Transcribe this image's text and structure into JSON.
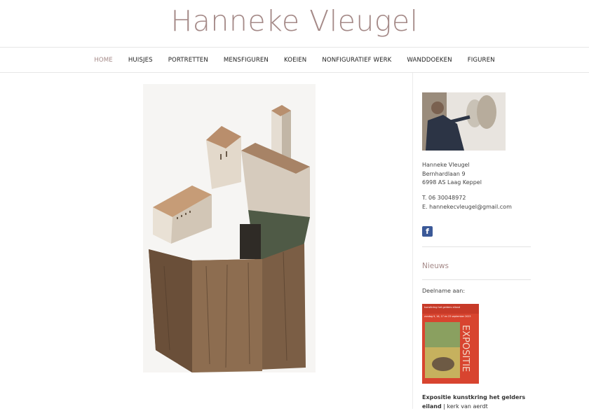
{
  "site": {
    "title": "Hanneke Vleugel"
  },
  "nav": {
    "items": [
      {
        "label": "HOME",
        "active": true
      },
      {
        "label": "HUISJES"
      },
      {
        "label": "PORTRETTEN"
      },
      {
        "label": "MENSFIGUREN"
      },
      {
        "label": "KOEIEN"
      },
      {
        "label": "NONFIGURATIEF WERK"
      },
      {
        "label": "WANDDOEKEN"
      },
      {
        "label": "FIGUREN"
      }
    ]
  },
  "sidebar": {
    "address": {
      "name": "Hanneke Vleugel",
      "street": "Bernhardlaan 9",
      "city": "6998 AS Laag Keppel"
    },
    "contact": {
      "phone": "T. 06 30048972",
      "email": "E. hannekecvleugel@gmail.com"
    },
    "facebook_glyph": "f",
    "news_heading": "Nieuws",
    "participation": "Deelname aan:",
    "poster": {
      "top_text": "kunstkring het gelders eiland",
      "date_text": "zondag 9, 16, 17 en 23 september 2023",
      "big_word": "EXPOSITIE"
    },
    "exhibition": {
      "title": "Expositie kunstkring het gelders eiland",
      "separator": "|",
      "location": "kerk van aerdt"
    }
  },
  "colors": {
    "accent": "#a58a88",
    "facebook": "#3b5998"
  }
}
